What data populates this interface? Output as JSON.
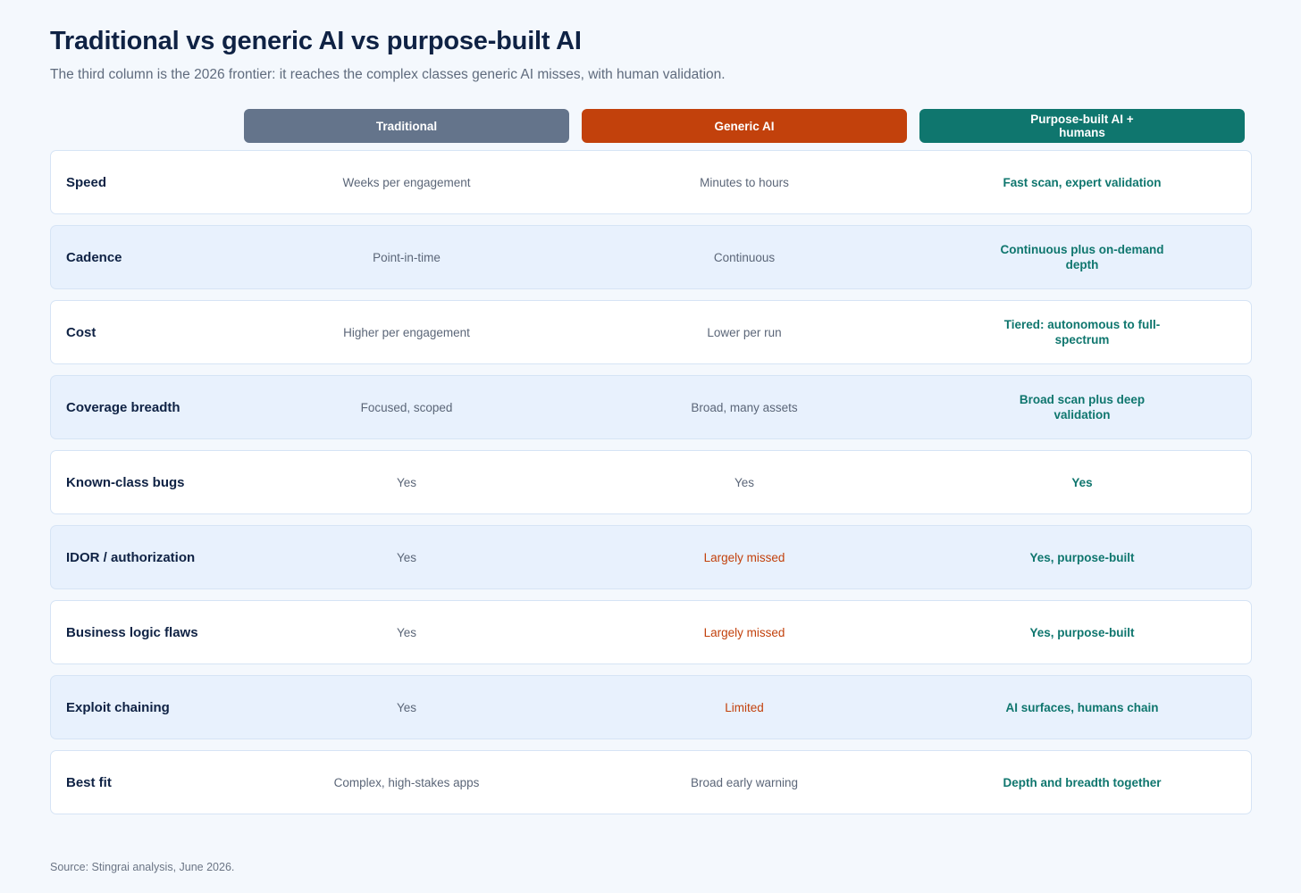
{
  "title": "Traditional vs generic AI vs purpose-built AI",
  "subtitle": "The third column is the 2026 frontier: it reaches the complex classes generic AI misses, with human validation.",
  "columns": [
    "Traditional",
    "Generic AI",
    "Purpose-built AI + humans"
  ],
  "colors": {
    "traditional": "#64748b",
    "generic_ai": "#c2410c",
    "purpose_built": "#0f766e",
    "missed_text": "#c2410c"
  },
  "rows": [
    {
      "label": "Speed",
      "traditional": "Weeks per engagement",
      "generic": "Minutes to hours",
      "generic_missed": false,
      "purpose": "Fast scan, expert validation"
    },
    {
      "label": "Cadence",
      "traditional": "Point-in-time",
      "generic": "Continuous",
      "generic_missed": false,
      "purpose": "Continuous plus on-demand depth"
    },
    {
      "label": "Cost",
      "traditional": "Higher per engagement",
      "generic": "Lower per run",
      "generic_missed": false,
      "purpose": "Tiered: autonomous to full-spectrum"
    },
    {
      "label": "Coverage breadth",
      "traditional": "Focused, scoped",
      "generic": "Broad, many assets",
      "generic_missed": false,
      "purpose": "Broad scan plus deep validation"
    },
    {
      "label": "Known-class bugs",
      "traditional": "Yes",
      "generic": "Yes",
      "generic_missed": false,
      "purpose": "Yes"
    },
    {
      "label": "IDOR / authorization",
      "traditional": "Yes",
      "generic": "Largely missed",
      "generic_missed": true,
      "purpose": "Yes, purpose-built"
    },
    {
      "label": "Business logic flaws",
      "traditional": "Yes",
      "generic": "Largely missed",
      "generic_missed": true,
      "purpose": "Yes, purpose-built"
    },
    {
      "label": "Exploit chaining",
      "traditional": "Yes",
      "generic": "Limited",
      "generic_missed": true,
      "purpose": "AI surfaces, humans chain"
    },
    {
      "label": "Best fit",
      "traditional": "Complex, high-stakes apps",
      "generic": "Broad early warning",
      "generic_missed": false,
      "purpose": "Depth and breadth together"
    }
  ],
  "source": "Source: Stingrai analysis, June 2026."
}
